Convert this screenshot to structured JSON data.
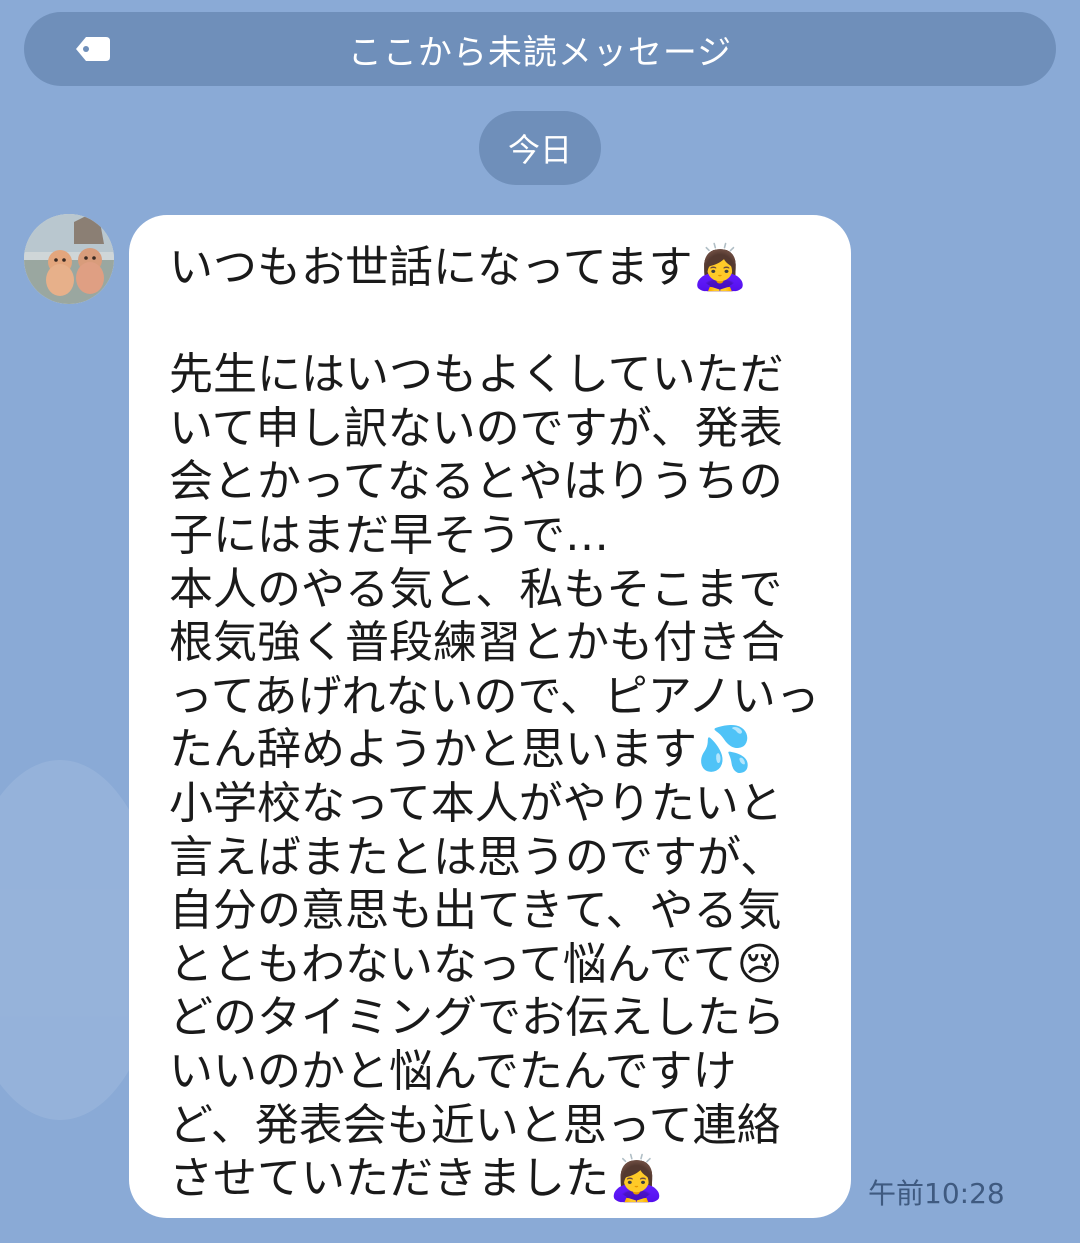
{
  "unread_banner": {
    "label": "ここから未読メッセージ",
    "icon": "tag-icon"
  },
  "date_separator": {
    "label": "今日"
  },
  "message": {
    "avatar_icon": "avatar",
    "text": "いつもお世話になってます🙇‍♀️\n\n先生にはいつもよくしていただいて申し訳ないのですが、発表会とかってなるとやはりうちの子にはまだ早そうで…\n本人のやる気と、私もそこまで根気強く普段練習とかも付き合ってあげれないので、ピアノいったん辞めようかと思います💦\n小学校なって本人がやりたいと言えばまたとは思うのですが、自分の意思も出てきて、やる気とともわないなって悩んでて😢\nどのタイミングでお伝えしたらいいのかと悩んでたんですけど、発表会も近いと思って連絡させていただきました🙇‍♀️",
    "time": "午前10:28"
  },
  "colors": {
    "background": "#8aaad6",
    "pill": "#6f8fba",
    "bubble": "#ffffff",
    "timestamp": "#3f5a80"
  }
}
